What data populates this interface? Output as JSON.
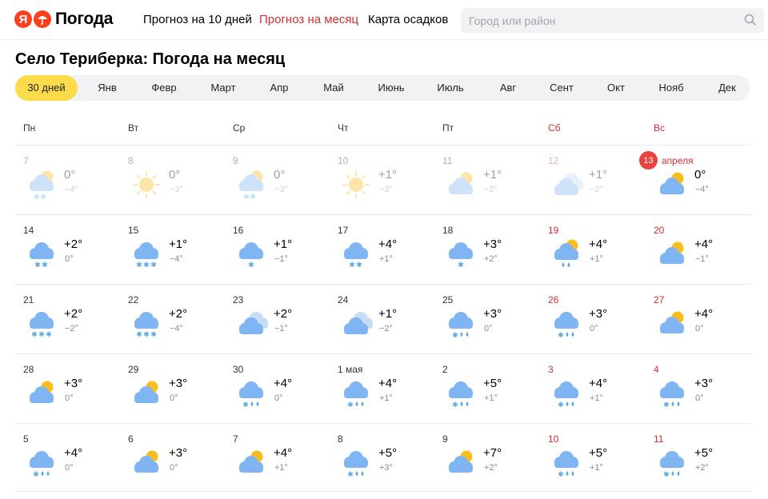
{
  "header": {
    "logo_letter": "Я",
    "logo_text": "Погода",
    "nav": [
      {
        "label": "Прогноз на 10 дней",
        "active": false
      },
      {
        "label": "Прогноз на месяц",
        "active": true
      },
      {
        "label": "Карта осадков",
        "active": false
      }
    ],
    "search_placeholder": "Город или район"
  },
  "title": "Село Териберка: Погода на месяц",
  "months": [
    {
      "label": "30 дней",
      "active": true
    },
    {
      "label": "Янв"
    },
    {
      "label": "Февр"
    },
    {
      "label": "Март"
    },
    {
      "label": "Апр"
    },
    {
      "label": "Май"
    },
    {
      "label": "Июнь"
    },
    {
      "label": "Июль"
    },
    {
      "label": "Авг"
    },
    {
      "label": "Сент"
    },
    {
      "label": "Окт"
    },
    {
      "label": "Нояб"
    },
    {
      "label": "Дек"
    }
  ],
  "weekdays": [
    {
      "label": "Пн",
      "weekend": false
    },
    {
      "label": "Вт",
      "weekend": false
    },
    {
      "label": "Ср",
      "weekend": false
    },
    {
      "label": "Чт",
      "weekend": false
    },
    {
      "label": "Пт",
      "weekend": false
    },
    {
      "label": "Сб",
      "weekend": true
    },
    {
      "label": "Вс",
      "weekend": true
    }
  ],
  "today_month_label": "апреля",
  "weeks": [
    [
      {
        "date": "7",
        "icon": "cloud-sun-snow-icon",
        "day": "0°",
        "night": "−4°",
        "past": true
      },
      {
        "date": "8",
        "icon": "sun-icon",
        "day": "0°",
        "night": "−3°",
        "past": true
      },
      {
        "date": "9",
        "icon": "cloud-sun-snow-icon",
        "day": "0°",
        "night": "−3°",
        "past": true
      },
      {
        "date": "10",
        "icon": "sun-icon",
        "day": "+1°",
        "night": "−3°",
        "past": true
      },
      {
        "date": "11",
        "icon": "cloud-sun-icon",
        "day": "+1°",
        "night": "−2°",
        "past": true
      },
      {
        "date": "12",
        "icon": "cloudy-icon",
        "day": "+1°",
        "night": "−2°",
        "past": true,
        "weekend": true
      },
      {
        "date": "13",
        "icon": "cloud-sun-icon",
        "day": "0°",
        "night": "−4°",
        "today": true,
        "weekend": true
      }
    ],
    [
      {
        "date": "14",
        "icon": "cloud-snow-icon",
        "day": "+2°",
        "night": "0°"
      },
      {
        "date": "15",
        "icon": "cloud-heavy-snow-icon",
        "day": "+1°",
        "night": "−4°"
      },
      {
        "date": "16",
        "icon": "cloud-light-snow-icon",
        "day": "+1°",
        "night": "−1°"
      },
      {
        "date": "17",
        "icon": "cloud-snow-icon",
        "day": "+4°",
        "night": "+1°"
      },
      {
        "date": "18",
        "icon": "cloud-light-snow-icon",
        "day": "+3°",
        "night": "+2°"
      },
      {
        "date": "19",
        "icon": "cloud-sun-rain-icon",
        "day": "+4°",
        "night": "+1°",
        "weekend": true
      },
      {
        "date": "20",
        "icon": "cloud-sun-icon",
        "day": "+4°",
        "night": "−1°",
        "weekend": true
      }
    ],
    [
      {
        "date": "21",
        "icon": "cloud-heavy-snow-icon",
        "day": "+2°",
        "night": "−2°"
      },
      {
        "date": "22",
        "icon": "cloud-heavy-snow-icon",
        "day": "+2°",
        "night": "−4°"
      },
      {
        "date": "23",
        "icon": "cloudy-icon",
        "day": "+2°",
        "night": "−1°"
      },
      {
        "date": "24",
        "icon": "cloudy-icon",
        "day": "+1°",
        "night": "−2°"
      },
      {
        "date": "25",
        "icon": "cloud-sleet-icon",
        "day": "+3°",
        "night": "0°"
      },
      {
        "date": "26",
        "icon": "cloud-sleet-icon",
        "day": "+3°",
        "night": "0°",
        "weekend": true
      },
      {
        "date": "27",
        "icon": "cloud-sun-icon",
        "day": "+4°",
        "night": "0°",
        "weekend": true
      }
    ],
    [
      {
        "date": "28",
        "icon": "cloud-sun-icon",
        "day": "+3°",
        "night": "0°"
      },
      {
        "date": "29",
        "icon": "cloud-sun-icon",
        "day": "+3°",
        "night": "0°"
      },
      {
        "date": "30",
        "icon": "cloud-sleet-icon",
        "day": "+4°",
        "night": "0°"
      },
      {
        "date": "1 мая",
        "icon": "cloud-sleet-icon",
        "day": "+4°",
        "night": "+1°"
      },
      {
        "date": "2",
        "icon": "cloud-sleet-icon",
        "day": "+5°",
        "night": "+1°"
      },
      {
        "date": "3",
        "icon": "cloud-sleet-icon",
        "day": "+4°",
        "night": "+1°",
        "weekend": true
      },
      {
        "date": "4",
        "icon": "cloud-sleet-icon",
        "day": "+3°",
        "night": "0°",
        "weekend": true
      }
    ],
    [
      {
        "date": "5",
        "icon": "cloud-sleet-icon",
        "day": "+4°",
        "night": "0°"
      },
      {
        "date": "6",
        "icon": "cloud-sun-icon",
        "day": "+3°",
        "night": "0°"
      },
      {
        "date": "7",
        "icon": "cloud-sun-icon",
        "day": "+4°",
        "night": "+1°"
      },
      {
        "date": "8",
        "icon": "cloud-sleet-icon",
        "day": "+5°",
        "night": "+3°"
      },
      {
        "date": "9",
        "icon": "cloud-sun-icon",
        "day": "+7°",
        "night": "+2°"
      },
      {
        "date": "10",
        "icon": "cloud-sleet-icon",
        "day": "+5°",
        "night": "+1°",
        "weekend": true
      },
      {
        "date": "11",
        "icon": "cloud-sleet-icon",
        "day": "+5°",
        "night": "+2°",
        "weekend": true
      }
    ]
  ],
  "colors": {
    "accent_red": "#d52e33",
    "active_tab": "#fddc4a",
    "sun": "#fbbd1c",
    "cloud": "#7fb5f2",
    "snow": "#5aa9e6"
  }
}
